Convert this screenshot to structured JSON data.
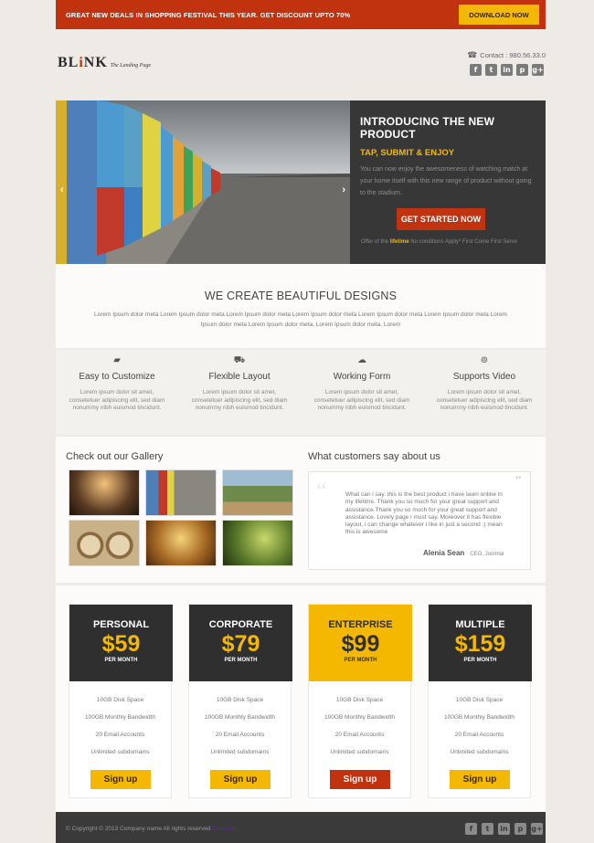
{
  "promo": {
    "text": "GREAT NEW DEALS IN SHOPPING FESTIVAL THIS YEAR. GET DISCOUNT UPTO 70%",
    "button": "DOWNLOAD NOW"
  },
  "header": {
    "logo_prefix": "BL",
    "logo_accent": "i",
    "logo_suffix": "NK",
    "logo_tagline": "The Landing Page",
    "contact": "Contact : 980.56.33.0",
    "social": [
      {
        "icon": "facebook-icon",
        "glyph": "f"
      },
      {
        "icon": "twitter-icon",
        "glyph": "t"
      },
      {
        "icon": "linkedin-icon",
        "glyph": "in"
      },
      {
        "icon": "pinterest-icon",
        "glyph": "p"
      },
      {
        "icon": "google-plus-icon",
        "glyph": "g+"
      }
    ]
  },
  "hero": {
    "prev": "‹",
    "next": "›",
    "title": "INTRODUCING THE NEW PRODUCT",
    "subtitle": "TAP, SUBMIT & ENJOY",
    "description": "You can now enjoy the awesomeness of watching match at your home itself with this new range of product without going to the stadium.",
    "button": "GET STARTED NOW",
    "offer_prefix": "Offer of the ",
    "offer_highlight": "lifetime",
    "offer_suffix": " No conditions Apply* First Come First Serve"
  },
  "designs": {
    "title": "WE CREATE BEAUTIFUL DESIGNS",
    "text": "Lorem Ipsum dolor meta Lorem Ipsum dolor meta Lorem Ipsum dolor meta Lorem Ipsum dolor meta Lorem Ipsum dolor meta Lorem Ipsum dolor meta Lorem Ipsum dolor meta Lorem Ipsum dolor meta, Lorem Ipsum dolor meta, Lorem"
  },
  "features": [
    {
      "icon": "chat-icon",
      "glyph": "▰",
      "title": "Easy to Customize",
      "text": "Lorem ipsum dolor sit amet, consetetuer adipiscing elit, sed diam nonummy nibh euismod tincidunt."
    },
    {
      "icon": "cart-icon",
      "glyph": "⛟",
      "title": "Flexible Layout",
      "text": "Lorem ipsum dolor sit amet, consetetuer adipiscing elit, sed diam nonummy nibh euismod tincidunt."
    },
    {
      "icon": "cloud-icon",
      "glyph": "☁",
      "title": "Working Form",
      "text": "Lorem ipsum dolor sit amet, consetetuer adipiscing elit, sed diam nonummy nibh euismod tincidunt."
    },
    {
      "icon": "broadcast-icon",
      "glyph": "⊚",
      "title": "Supports Video",
      "text": "Lorem ipsum dolor sit amet, consetetuer adipiscing elit, sed diam nonummy nibh euismod tincidunt."
    }
  ],
  "gallery": {
    "title": "Check out our Gallery"
  },
  "testimonials": {
    "title": "What customers say about us",
    "quote": "What can i say. this is the best product i have seen online in my lifetime. Thank you so much for your great support and assistance.Thank you so much for your great support and assistance. Lovely page i must say. Moreover it has flexible layout, i can change whatever i like in just a second :) mean this is awesome",
    "author": "Alenia Sean",
    "role": "CEO, Joomlar",
    "nav": "‹›"
  },
  "pricing": [
    {
      "name": "PERSONAL",
      "price": "$59",
      "per": "PER MONTH",
      "features": [
        "10GB Disk Space",
        "100GB Monthly Bandwidth",
        "20 Email Accounts",
        "Unlimited subdomains"
      ],
      "button": "Sign up",
      "featured": false
    },
    {
      "name": "CORPORATE",
      "price": "$79",
      "per": "PER MONTH",
      "features": [
        "10GB Disk Space",
        "100GB Monthly Bandwidth",
        "20 Email Accounts",
        "Unlimited subdomains"
      ],
      "button": "Sign up",
      "featured": false
    },
    {
      "name": "ENTERPRISE",
      "price": "$99",
      "per": "PER MONTH",
      "features": [
        "10GB Disk Space",
        "100GB Monthly Bandwidth",
        "20 Email Accounts",
        "Unlimited subdomains"
      ],
      "button": "Sign up",
      "featured": true
    },
    {
      "name": "MULTIPLE",
      "price": "$159",
      "per": "PER MONTH",
      "features": [
        "10GB Disk Space",
        "100GB Monthly Bandwidth",
        "20 Email Accounts",
        "Unlimited subdomains"
      ],
      "button": "Sign up",
      "featured": false
    }
  ],
  "footer": {
    "copyright": "© Copyright © 2013 Company name All rights reserved ",
    "highlight": "Template"
  },
  "colors": {
    "brand_red": "#c1320f",
    "accent_yellow": "#f5b800",
    "dark_panel": "#373737"
  }
}
